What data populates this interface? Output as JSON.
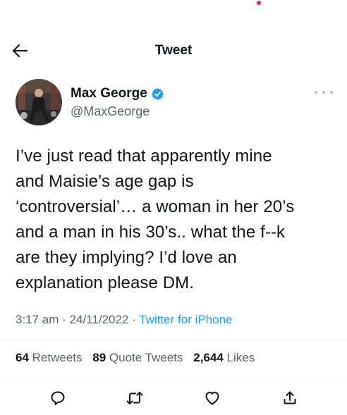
{
  "header": {
    "title": "Tweet",
    "back_icon": "arrow-left-icon"
  },
  "author": {
    "name": "Max George",
    "handle": "@MaxGeorge",
    "verified": true
  },
  "tweet": {
    "lines": [
      "I’ve just read that apparently mine",
      "and Maisie’s age gap is",
      "‘controversial’… a woman in her 20’s",
      "and a man in his 30’s.. what the f--k",
      "are they implying? I’d love an",
      "explanation please DM."
    ],
    "time": "3:17 am",
    "date": "24/11/2022",
    "source": "Twitter for iPhone"
  },
  "stats": {
    "retweets_count": "64",
    "retweets_label": "Retweets",
    "quotes_count": "89",
    "quotes_label": "Quote Tweets",
    "likes_count": "2,644",
    "likes_label": "Likes"
  },
  "actions": [
    "reply-icon",
    "retweet-icon",
    "like-icon",
    "share-icon"
  ],
  "colors": {
    "text": "#0f1419",
    "secondary": "#536471",
    "link": "#1d9bf0",
    "divider": "#eff3f4",
    "notification_dot": "#e0245e"
  }
}
